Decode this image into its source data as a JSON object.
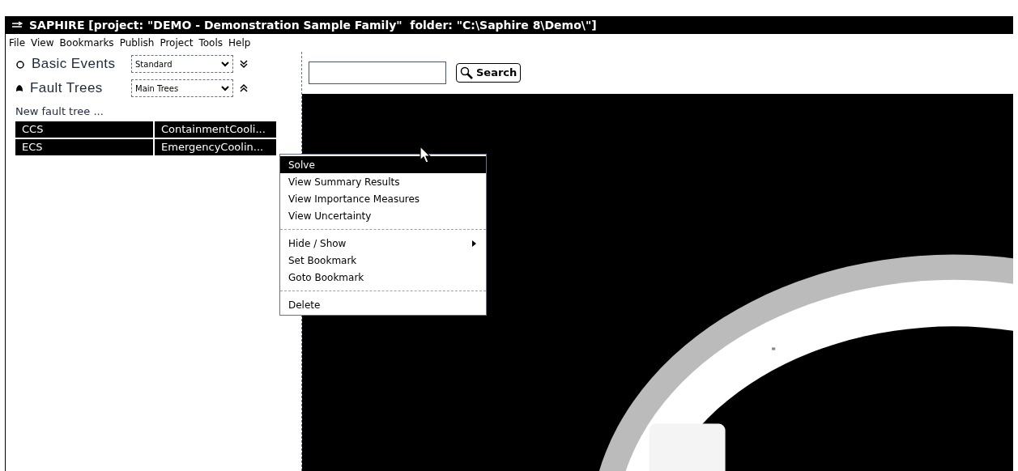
{
  "window": {
    "title": "SAPHIRE [project: \"DEMO - Demonstration Sample Family\"  folder: \"C:\\Saphire 8\\Demo\\\"]"
  },
  "menu_bar": [
    "File",
    "View",
    "Bookmarks",
    "Publish",
    "Project",
    "Tools",
    "Help"
  ],
  "sections": [
    {
      "label": "Basic Events",
      "kind": "basic",
      "filter": "Standard",
      "expanded": false
    },
    {
      "label": "Fault Trees",
      "kind": "tree",
      "filter": "Main Trees",
      "expanded": true
    }
  ],
  "new_item": "New fault tree ...",
  "rows": [
    {
      "name": "CCS",
      "description": "ContainmentCooli...",
      "selected": true
    },
    {
      "name": "ECS",
      "description": "EmergencyCoolin...",
      "selected": true
    }
  ],
  "search": {
    "button": "Search"
  },
  "context_menu": [
    [
      {
        "label": "Solve",
        "selected": true,
        "submenu": false
      },
      {
        "label": "View Summary Results",
        "selected": false,
        "submenu": false
      },
      {
        "label": "View Importance Measures",
        "selected": false,
        "submenu": false
      },
      {
        "label": "View Uncertainty",
        "selected": false,
        "submenu": false
      }
    ],
    [
      {
        "label": "Hide / Show",
        "selected": false,
        "submenu": true
      },
      {
        "label": "Set Bookmark",
        "selected": false,
        "submenu": false
      },
      {
        "label": "Goto Bookmark",
        "selected": false,
        "submenu": false
      }
    ],
    [
      {
        "label": "Delete",
        "selected": false,
        "submenu": false
      }
    ]
  ]
}
